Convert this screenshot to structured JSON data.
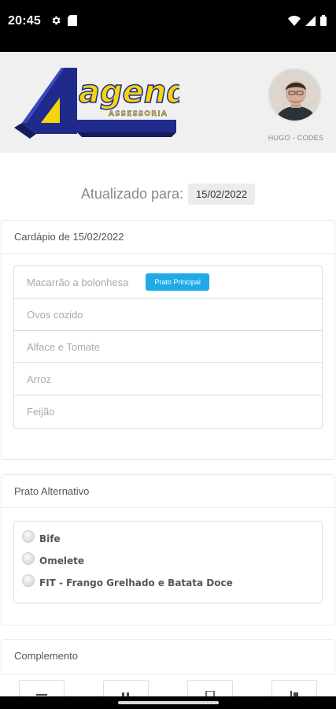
{
  "status_bar": {
    "time": "20:45",
    "icons_left": [
      "gear-icon",
      "sd-card-icon"
    ],
    "icons_right": [
      "wifi-icon",
      "signal-icon",
      "battery-icon"
    ]
  },
  "header": {
    "logo_text": "agenda",
    "logo_subtext": "ASSESSORIA",
    "avatar_name": "HUGO - CODES"
  },
  "updated": {
    "label": "Atualizado para:",
    "date": "15/02/2022"
  },
  "menu": {
    "title": "Cardápio de 15/02/2022",
    "items": [
      {
        "label": "Macarrão a bolonhesa",
        "badge": "Prato Principal"
      },
      {
        "label": "Ovos cozido"
      },
      {
        "label": "Alface e Tomate"
      },
      {
        "label": "Arroz"
      },
      {
        "label": "Feijão"
      }
    ]
  },
  "alternative": {
    "title": "Prato Alternativo",
    "options": [
      "Bife",
      "Omelete",
      "FIT - Frango Grelhado e Batata Doce"
    ]
  },
  "complement": {
    "title": "Complemento"
  },
  "colors": {
    "badge": "#1eaae7",
    "header_bg": "#f0f0f0",
    "logo_navy": "#1f2a8a",
    "logo_yellow": "#f6d40f"
  }
}
